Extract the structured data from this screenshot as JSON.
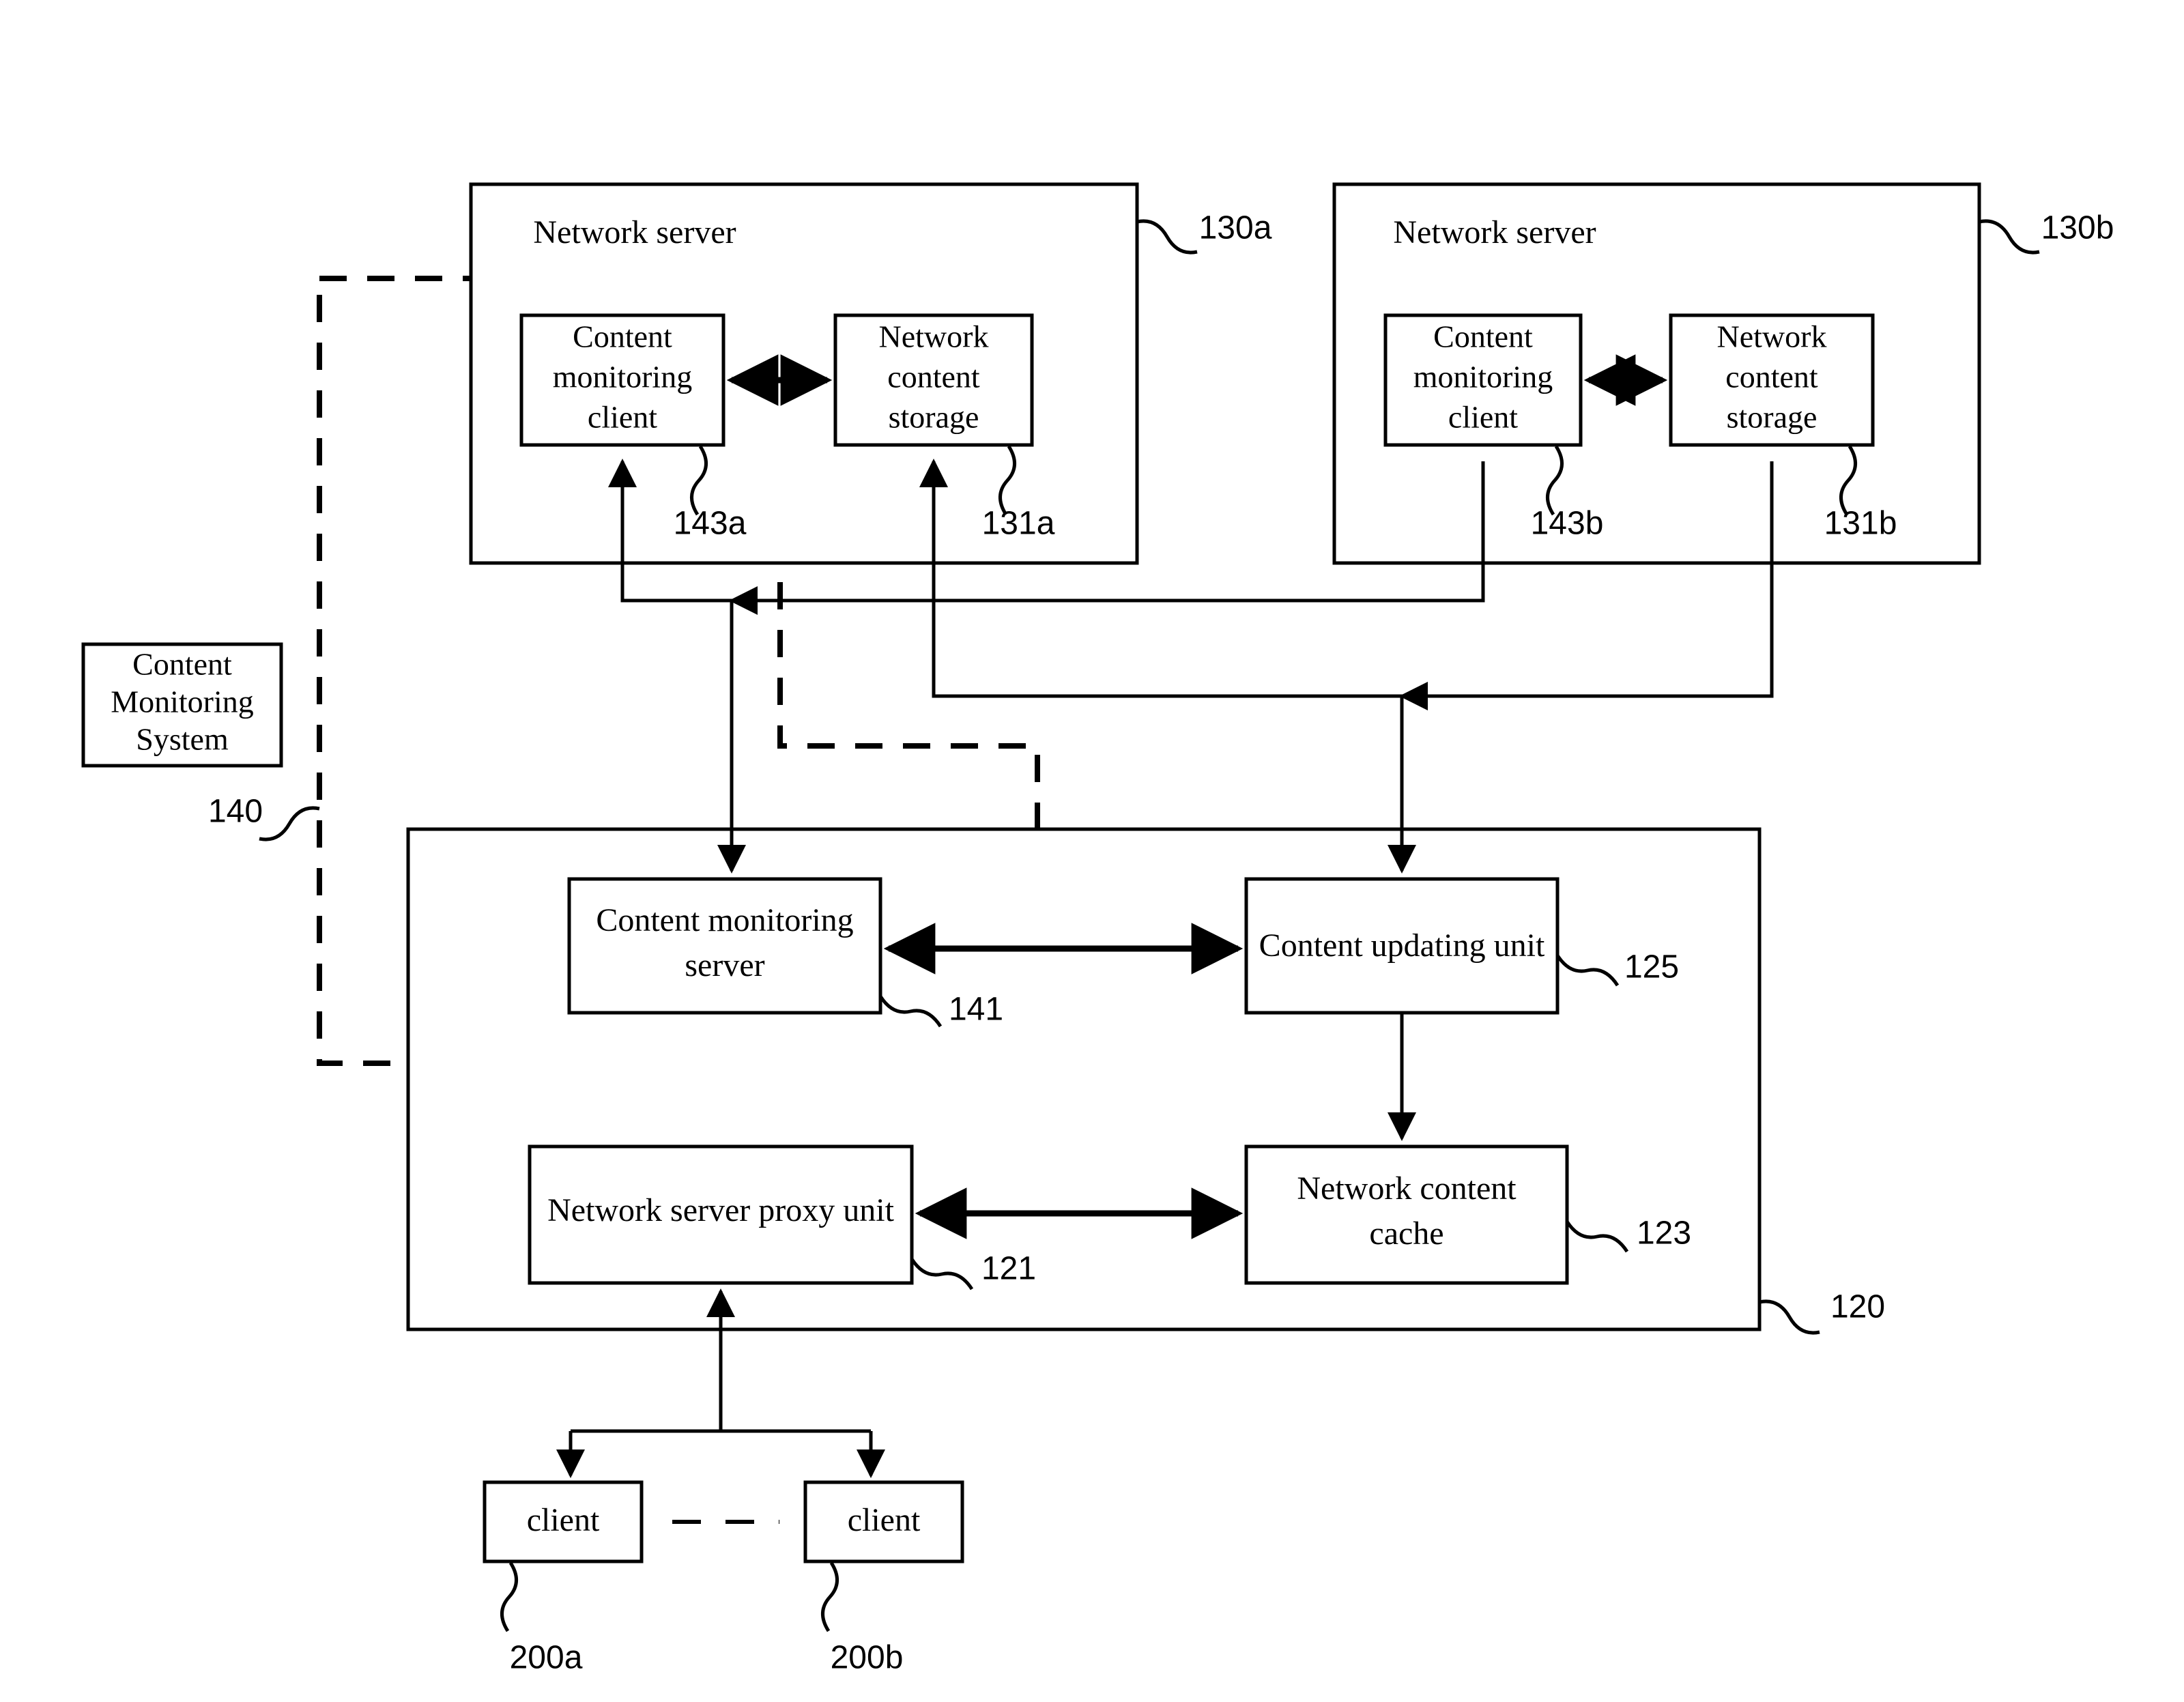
{
  "figure": {
    "title": "Content monitoring and caching system block diagram",
    "line_color": "#000000",
    "background_color": "#ffffff"
  },
  "blocks": {
    "network_server_a": {
      "label": "Network server",
      "ref": "130a"
    },
    "network_server_b": {
      "label": "Network server",
      "ref": "130b"
    },
    "content_monitoring_client_a": {
      "line1": "Content",
      "line2": "monitoring",
      "line3": "client",
      "ref": "143a"
    },
    "network_content_storage_a": {
      "line1": "Network",
      "line2": "content",
      "line3": "storage",
      "ref": "131a"
    },
    "content_monitoring_client_b": {
      "line1": "Content",
      "line2": "monitoring",
      "line3": "client",
      "ref": "143b"
    },
    "network_content_storage_b": {
      "line1": "Network",
      "line2": "content",
      "line3": "storage",
      "ref": "131b"
    },
    "content_monitoring_system": {
      "line1": "Content",
      "line2": "Monitoring",
      "line3": "System",
      "ref": "140"
    },
    "proxy_container": {
      "ref": "120"
    },
    "content_monitoring_server": {
      "line1": "Content monitoring",
      "line2": "server",
      "ref": "141"
    },
    "content_updating_unit": {
      "line1": "Content updating unit",
      "ref": "125"
    },
    "network_server_proxy_unit": {
      "line1": "Network server proxy unit",
      "ref": "121"
    },
    "network_content_cache": {
      "line1": "Network content",
      "line2": "cache",
      "ref": "123"
    },
    "client_a": {
      "label": "client",
      "ref": "200a"
    },
    "client_b": {
      "label": "client",
      "ref": "200b"
    }
  }
}
